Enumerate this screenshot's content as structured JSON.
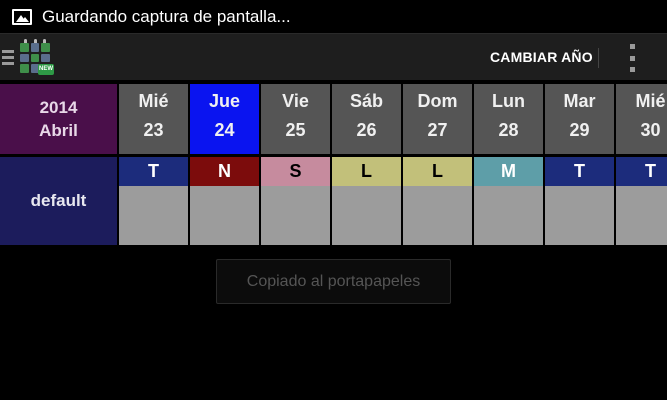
{
  "status_bar": {
    "icon": "image-icon",
    "text": "Guardando captura de pantalla..."
  },
  "action_bar": {
    "drawer_icon": "drawer-menu-icon",
    "app_icon": "calendar-app-icon",
    "app_icon_badge": "NEW",
    "change_year_label": "CAMBIAR AÑO",
    "overflow_icon": "overflow-menu-icon"
  },
  "calendar": {
    "year": "2014",
    "month": "Abril",
    "user": "default",
    "selected_day_index": 1,
    "selected_color": "#0a14f0",
    "days": [
      {
        "name": "Mié",
        "number": "23",
        "shift": "T",
        "shift_bg": "#1c2c7c",
        "shift_fg": "#ffffff"
      },
      {
        "name": "Jue",
        "number": "24",
        "shift": "N",
        "shift_bg": "#7c0c0c",
        "shift_fg": "#ffffff"
      },
      {
        "name": "Vie",
        "number": "25",
        "shift": "S",
        "shift_bg": "#c68b9e",
        "shift_fg": "#000000"
      },
      {
        "name": "Sáb",
        "number": "26",
        "shift": "L",
        "shift_bg": "#c2c07a",
        "shift_fg": "#000000"
      },
      {
        "name": "Dom",
        "number": "27",
        "shift": "L",
        "shift_bg": "#c2c07a",
        "shift_fg": "#000000"
      },
      {
        "name": "Lun",
        "number": "28",
        "shift": "M",
        "shift_bg": "#5e9ea8",
        "shift_fg": "#ffffff"
      },
      {
        "name": "Mar",
        "number": "29",
        "shift": "T",
        "shift_bg": "#1c2c7c",
        "shift_fg": "#ffffff"
      },
      {
        "name": "Mié",
        "number": "30",
        "shift": "T",
        "shift_bg": "#1c2c7c",
        "shift_fg": "#ffffff"
      }
    ]
  },
  "toast": {
    "text": "Copiado al portapapeles"
  }
}
